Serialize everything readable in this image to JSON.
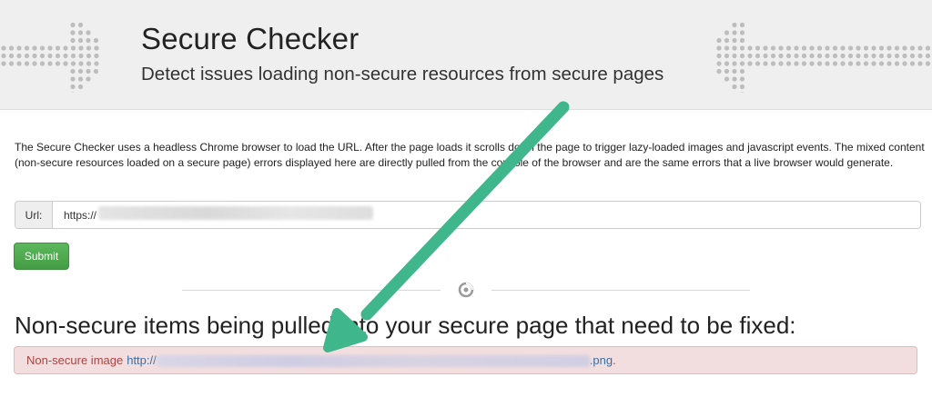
{
  "header": {
    "title": "Secure Checker",
    "subtitle": "Detect issues loading non-secure resources from secure pages"
  },
  "description": "The Secure Checker uses a headless Chrome browser to load the URL. After the page loads it scrolls down the page to trigger lazy-loaded images and javascript events. The mixed content (non-secure resources loaded on a secure page) errors displayed here are directly pulled from the console of the browser and are the same errors that a live browser would generate.",
  "form": {
    "url_label": "Url:",
    "url_value": "https://",
    "submit_label": "Submit"
  },
  "results": {
    "heading": "Non-secure items being pulled into your secure page that need to be fixed:",
    "alerts": [
      {
        "prefix": "Non-secure image",
        "link_start": "http://",
        "link_end": ".png",
        "suffix": "."
      }
    ]
  },
  "colors": {
    "header_bg": "#efefef",
    "submit": "#5cb85c",
    "alert_bg": "#f2dede",
    "alert_text": "#a94442",
    "link": "#3a6ea5",
    "annotation_arrow": "#3fb68b"
  },
  "icons": {
    "left_decor": "dotted-arrow-right",
    "right_decor": "dotted-arrow-left",
    "divider": "swirl-icon",
    "annotation": "annotation-arrow"
  }
}
